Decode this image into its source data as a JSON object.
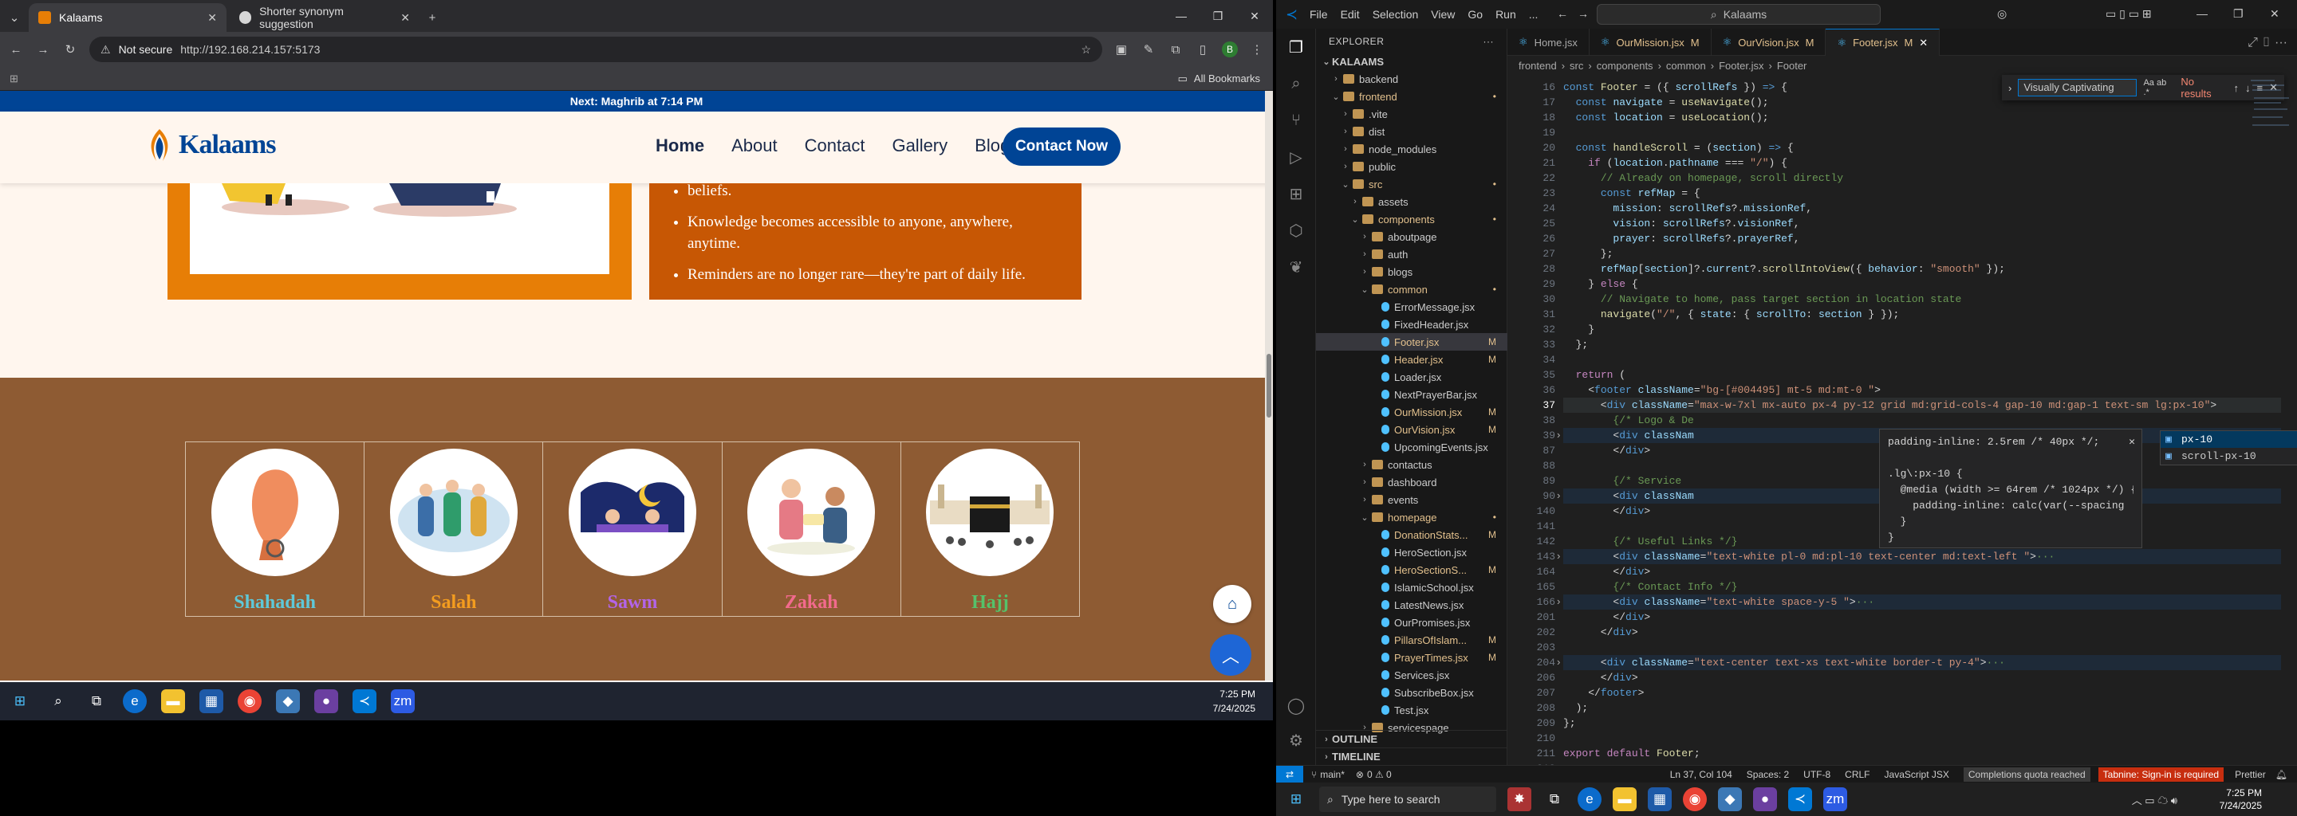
{
  "browser": {
    "tabs": [
      {
        "title": "Kalaams",
        "active": true
      },
      {
        "title": "Shorter synonym suggestion",
        "active": false
      }
    ],
    "security_label": "Not secure",
    "url": "http://192.168.214.157:5173",
    "bookmarks_label": "All Bookmarks"
  },
  "site": {
    "announcement": "Next: Maghrib at 7:14 PM",
    "logo_text": "Kalaams",
    "nav": [
      "Home",
      "About",
      "Contact",
      "Gallery",
      "Blogs"
    ],
    "cta": "Contact Now",
    "bullets": [
      "beliefs.",
      "Knowledge becomes accessible to anyone, anywhere, anytime.",
      "Reminders are no longer rare—they're part of daily life."
    ],
    "pillars": [
      {
        "name": "Shahadah",
        "color": "#5ec8d8"
      },
      {
        "name": "Salah",
        "color": "#f39c1f"
      },
      {
        "name": "Sawm",
        "color": "#b364e8"
      },
      {
        "name": "Zakah",
        "color": "#f26a8d"
      },
      {
        "name": "Hajj",
        "color": "#55c26a"
      }
    ]
  },
  "taskbar_left": {
    "time": "7:25 PM",
    "date": "7/24/2025"
  },
  "vscode": {
    "title_search": "Kalaams",
    "menu": [
      "File",
      "Edit",
      "Selection",
      "View",
      "Go",
      "Run",
      "..."
    ],
    "explorer_title": "EXPLORER",
    "root": "KALAAMS",
    "tree": [
      {
        "name": "backend",
        "lvl": 1,
        "type": "folder",
        "open": false
      },
      {
        "name": "frontend",
        "lvl": 1,
        "type": "folder",
        "open": true,
        "status": "•"
      },
      {
        "name": ".vite",
        "lvl": 2,
        "type": "folder"
      },
      {
        "name": "dist",
        "lvl": 2,
        "type": "folder"
      },
      {
        "name": "node_modules",
        "lvl": 2,
        "type": "folder"
      },
      {
        "name": "public",
        "lvl": 2,
        "type": "folder"
      },
      {
        "name": "src",
        "lvl": 2,
        "type": "folder",
        "open": true,
        "status": "•"
      },
      {
        "name": "assets",
        "lvl": 3,
        "type": "folder"
      },
      {
        "name": "components",
        "lvl": 3,
        "type": "folder",
        "open": true,
        "status": "•"
      },
      {
        "name": "aboutpage",
        "lvl": 4,
        "type": "folder"
      },
      {
        "name": "auth",
        "lvl": 4,
        "type": "folder"
      },
      {
        "name": "blogs",
        "lvl": 4,
        "type": "folder"
      },
      {
        "name": "common",
        "lvl": 4,
        "type": "folder",
        "open": true,
        "status": "•"
      },
      {
        "name": "ErrorMessage.jsx",
        "lvl": 5,
        "type": "file"
      },
      {
        "name": "FixedHeader.jsx",
        "lvl": 5,
        "type": "file"
      },
      {
        "name": "Footer.jsx",
        "lvl": 5,
        "type": "file",
        "status": "M",
        "selected": true
      },
      {
        "name": "Header.jsx",
        "lvl": 5,
        "type": "file",
        "status": "M"
      },
      {
        "name": "Loader.jsx",
        "lvl": 5,
        "type": "file"
      },
      {
        "name": "NextPrayerBar.jsx",
        "lvl": 5,
        "type": "file"
      },
      {
        "name": "OurMission.jsx",
        "lvl": 5,
        "type": "file",
        "status": "M"
      },
      {
        "name": "OurVision.jsx",
        "lvl": 5,
        "type": "file",
        "status": "M"
      },
      {
        "name": "UpcomingEvents.jsx",
        "lvl": 5,
        "type": "file"
      },
      {
        "name": "contactus",
        "lvl": 4,
        "type": "folder"
      },
      {
        "name": "dashboard",
        "lvl": 4,
        "type": "folder"
      },
      {
        "name": "events",
        "lvl": 4,
        "type": "folder"
      },
      {
        "name": "homepage",
        "lvl": 4,
        "type": "folder",
        "open": true,
        "status": "•"
      },
      {
        "name": "DonationStats...",
        "lvl": 5,
        "type": "file",
        "status": "M"
      },
      {
        "name": "HeroSection.jsx",
        "lvl": 5,
        "type": "file"
      },
      {
        "name": "HeroSectionS...",
        "lvl": 5,
        "type": "file",
        "status": "M"
      },
      {
        "name": "IslamicSchool.jsx",
        "lvl": 5,
        "type": "file"
      },
      {
        "name": "LatestNews.jsx",
        "lvl": 5,
        "type": "file"
      },
      {
        "name": "OurPromises.jsx",
        "lvl": 5,
        "type": "file"
      },
      {
        "name": "PillarsOfIslam...",
        "lvl": 5,
        "type": "file",
        "status": "M"
      },
      {
        "name": "PrayerTimes.jsx",
        "lvl": 5,
        "type": "file",
        "status": "M"
      },
      {
        "name": "Services.jsx",
        "lvl": 5,
        "type": "file"
      },
      {
        "name": "SubscribeBox.jsx",
        "lvl": 5,
        "type": "file"
      },
      {
        "name": "Test.jsx",
        "lvl": 5,
        "type": "file"
      },
      {
        "name": "servicespage",
        "lvl": 4,
        "type": "folder"
      }
    ],
    "outline": "OUTLINE",
    "timeline": "TIMELINE",
    "tabs": [
      {
        "name": "Home.jsx",
        "status": ""
      },
      {
        "name": "OurMission.jsx",
        "status": "M"
      },
      {
        "name": "OurVision.jsx",
        "status": "M"
      },
      {
        "name": "Footer.jsx",
        "status": "M",
        "active": true
      }
    ],
    "breadcrumb": [
      "frontend",
      "src",
      "components",
      "common",
      "Footer.jsx",
      "Footer"
    ],
    "find_value": "Visually Captivating",
    "find_result": "No results",
    "lines": [
      {
        "n": "16",
        "html": "<span class='kw'>const</span> <span class='fn'>Footer</span> = ({ <span class='var'>scrollRefs</span> }) <span class='kw'>=&gt;</span> {"
      },
      {
        "n": "17",
        "html": "  <span class='kw'>const</span> <span class='var'>navigate</span> = <span class='fn'>useNavigate</span>();"
      },
      {
        "n": "18",
        "html": "  <span class='kw'>const</span> <span class='var'>location</span> = <span class='fn'>useLocation</span>();"
      },
      {
        "n": "19",
        "html": ""
      },
      {
        "n": "20",
        "html": "  <span class='kw'>const</span> <span class='fn'>handleScroll</span> = (<span class='var'>section</span>) <span class='kw'>=&gt;</span> {"
      },
      {
        "n": "21",
        "html": "    <span class='kw2'>if</span> (<span class='var'>location</span>.<span class='var'>pathname</span> === <span class='str'>\"/\"</span>) {"
      },
      {
        "n": "22",
        "html": "      <span class='cm'>// Already on homepage, scroll directly</span>"
      },
      {
        "n": "23",
        "html": "      <span class='kw'>const</span> <span class='var'>refMap</span> = {"
      },
      {
        "n": "24",
        "html": "        <span class='var'>mission</span>: <span class='var'>scrollRefs</span>?.<span class='var'>missionRef</span>,"
      },
      {
        "n": "25",
        "html": "        <span class='var'>vision</span>: <span class='var'>scrollRefs</span>?.<span class='var'>visionRef</span>,"
      },
      {
        "n": "26",
        "html": "        <span class='var'>prayer</span>: <span class='var'>scrollRefs</span>?.<span class='var'>prayerRef</span>,"
      },
      {
        "n": "27",
        "html": "      };"
      },
      {
        "n": "28",
        "html": "      <span class='var'>refMap</span>[<span class='var'>section</span>]?.<span class='var'>current</span>?.<span class='fn'>scrollIntoView</span>({ <span class='var'>behavior</span>: <span class='str'>\"smooth\"</span> });"
      },
      {
        "n": "29",
        "html": "    } <span class='kw2'>else</span> {"
      },
      {
        "n": "30",
        "html": "      <span class='cm'>// Navigate to home, pass target section in location state</span>"
      },
      {
        "n": "31",
        "html": "      <span class='fn'>navigate</span>(<span class='str'>\"/\"</span>, { <span class='var'>state</span>: { <span class='var'>scrollTo</span>: <span class='var'>section</span> } });"
      },
      {
        "n": "32",
        "html": "    }"
      },
      {
        "n": "33",
        "html": "  };"
      },
      {
        "n": "34",
        "html": ""
      },
      {
        "n": "35",
        "html": "  <span class='kw2'>return</span> ("
      },
      {
        "n": "36",
        "html": "    &lt;<span class='tag'>footer</span> <span class='att'>className</span>=<span class='str'>\"bg-[#004495] mt-5 md:mt-0 \"</span>&gt;"
      },
      {
        "n": "37",
        "html": "      &lt;<span class='tag'>div</span> <span class='att'>className</span>=<span class='str'>\"max-w-7xl mx-auto px-4 py-12 grid md:grid-cols-4 gap-10 md:gap-1 text-sm lg:px-10\"</span>&gt;"
      },
      {
        "n": "38",
        "html": "        <span class='cm'>{/* Logo &amp; De</span>"
      },
      {
        "n": "39",
        "html": "        &lt;<span class='tag'>div</span> <span class='att'>classNam</span>"
      },
      {
        "n": "87",
        "html": "        &lt;/<span class='tag'>div</span>&gt;"
      },
      {
        "n": "88",
        "html": ""
      },
      {
        "n": "89",
        "html": "        <span class='cm'>{/* Service</span>"
      },
      {
        "n": "90",
        "html": "        &lt;<span class='tag'>div</span> <span class='att'>classNam</span>"
      },
      {
        "n": "140",
        "html": "        &lt;/<span class='tag'>div</span>&gt;"
      },
      {
        "n": "141",
        "html": ""
      },
      {
        "n": "142",
        "html": "        <span class='cm'>{/* Useful Links */}</span>"
      },
      {
        "n": "143",
        "html": "        &lt;<span class='tag'>div</span> <span class='att'>className</span>=<span class='str'>\"text-white pl-0 md:pl-10 text-center md:text-left \"</span>&gt;<span class='cm'>···</span>"
      },
      {
        "n": "164",
        "html": "        &lt;/<span class='tag'>div</span>&gt;"
      },
      {
        "n": "165",
        "html": "        <span class='cm'>{/* Contact Info */}</span>"
      },
      {
        "n": "166",
        "html": "        &lt;<span class='tag'>div</span> <span class='att'>className</span>=<span class='str'>\"text-white space-y-5 \"</span>&gt;<span class='cm'>···</span>"
      },
      {
        "n": "201",
        "html": "        &lt;/<span class='tag'>div</span>&gt;"
      },
      {
        "n": "202",
        "html": "      &lt;/<span class='tag'>div</span>&gt;"
      },
      {
        "n": "203",
        "html": ""
      },
      {
        "n": "204",
        "html": "      &lt;<span class='tag'>div</span> <span class='att'>className</span>=<span class='str'>\"text-center text-xs text-white border-t py-4\"</span>&gt;<span class='cm'>···</span>"
      },
      {
        "n": "206",
        "html": "      &lt;/<span class='tag'>div</span>&gt;"
      },
      {
        "n": "207",
        "html": "    &lt;/<span class='tag'>footer</span>&gt;"
      },
      {
        "n": "208",
        "html": "  );"
      },
      {
        "n": "209",
        "html": "};"
      },
      {
        "n": "210",
        "html": ""
      },
      {
        "n": "211",
        "html": "<span class='kw2'>export</span> <span class='kw2'>default</span> <span class='fn'>Footer</span>;"
      },
      {
        "n": "212",
        "html": ""
      }
    ],
    "hover_lines": [
      "padding-inline: 2.5rem /* 40px */;",
      "",
      ".lg\\:px-10 {",
      "  @media (width >= 64rem /* 1024px */) {",
      "    padding-inline: calc(var(--spacing",
      "  }",
      "}"
    ],
    "suggestions": [
      "px-10",
      "scroll-px-10"
    ],
    "status": {
      "branch": "main*",
      "problems": "0 ⚠ 0",
      "position": "Ln 37, Col 104",
      "spaces": "Spaces: 2",
      "encoding": "UTF-8",
      "eol": "CRLF",
      "language": "JavaScript JSX",
      "quota": "Completions quota reached",
      "tabnine": "Tabnine: Sign-in is required",
      "prettier": "Prettier"
    }
  },
  "taskbar_right": {
    "search_placeholder": "Type here to search",
    "time": "7:25 PM",
    "date": "7/24/2025"
  }
}
